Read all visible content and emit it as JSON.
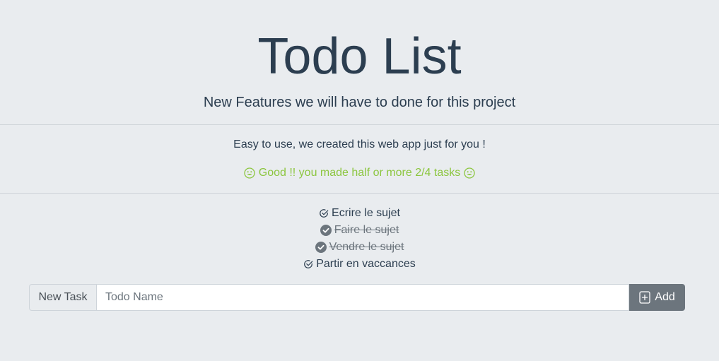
{
  "header": {
    "title": "Todo List",
    "subtitle": "New Features we will have to done for this project"
  },
  "intro": {
    "lead": "Easy to use, we created this web app just for you !",
    "status": "Good !! you made half or more 2/4 tasks",
    "status_color": "#8cc63f"
  },
  "todos": [
    {
      "label": "Ecrire le sujet",
      "done": false,
      "icon": "check-outline-icon"
    },
    {
      "label": "Faire le sujet",
      "done": true,
      "icon": "check-filled-icon"
    },
    {
      "label": "Vendre le sujet",
      "done": true,
      "icon": "check-filled-icon"
    },
    {
      "label": "Partir en vaccances",
      "done": false,
      "icon": "check-outline-icon"
    }
  ],
  "form": {
    "prepend_label": "New Task",
    "input_placeholder": "Todo Name",
    "input_value": "",
    "add_label": "Add",
    "add_color": "#6c757d"
  }
}
